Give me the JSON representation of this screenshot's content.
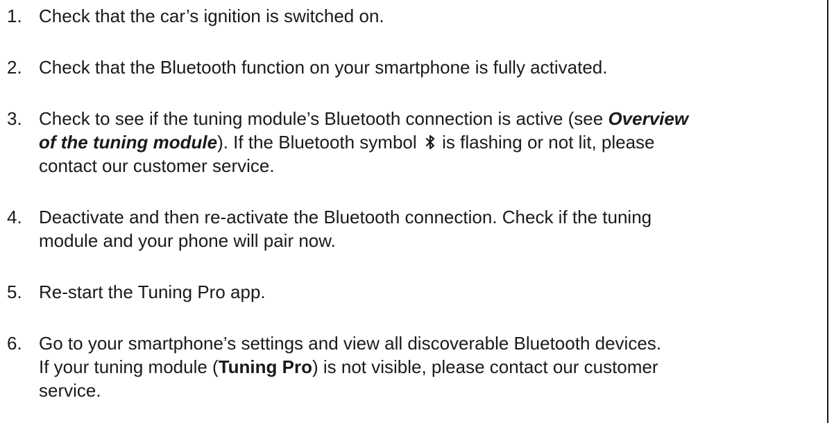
{
  "steps": [
    {
      "number": "1.",
      "text": "Check that the car’s ignition is switched on."
    },
    {
      "number": "2.",
      "text": "Check that the Bluetooth function on your smartphone is fully activated."
    },
    {
      "number": "3.",
      "part1": "Check to see if the tuning module’s Bluetooth connection is active (see ",
      "link_a": "Overview",
      "link_b": "of the tuning module",
      "part2": "). If the Bluetooth symbol ",
      "icon": "bluetooth-icon",
      "part3": " is flashing or not lit, please",
      "part4": "contact our customer service."
    },
    {
      "number": "4.",
      "line1": "Deactivate and then re-activate the Bluetooth connection. Check if the tuning",
      "line2": "module and your phone will pair now."
    },
    {
      "number": "5.",
      "text": "Re-start the Tuning Pro app."
    },
    {
      "number": "6.",
      "line1": "Go to your smartphone’s settings and view all discoverable Bluetooth devices.",
      "line2a": "If your tuning module (",
      "bold": "Tuning Pro",
      "line2b": ") is not visible, please contact our customer",
      "line3": "service."
    }
  ]
}
